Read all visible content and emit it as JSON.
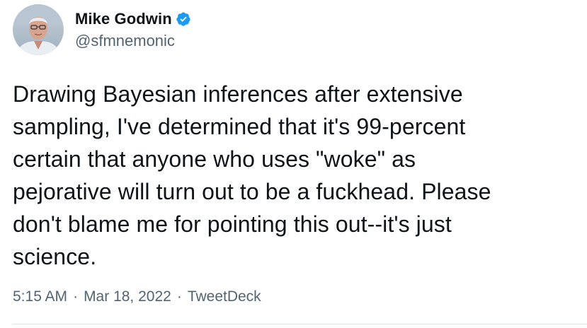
{
  "author": {
    "display_name": "Mike Godwin",
    "handle": "@sfmnemonic",
    "verified_icon": "verified-badge-icon",
    "avatar_icon": "profile-photo"
  },
  "tweet": {
    "text": "Drawing Bayesian inferences after extensive\nsampling, I've determined that it's 99-percent\ncertain that anyone who uses \"woke\" as\npejorative will turn out to be a fuckhead. Please\ndon't blame me for pointing this out--it's just\nscience.",
    "time": "5:15 AM",
    "separator": "·",
    "date": "Mar 18, 2022",
    "source": "TweetDeck"
  },
  "colors": {
    "text": "#0f1419",
    "secondary": "#536471",
    "verified": "#1d9bf0",
    "divider": "#dde3e8"
  }
}
